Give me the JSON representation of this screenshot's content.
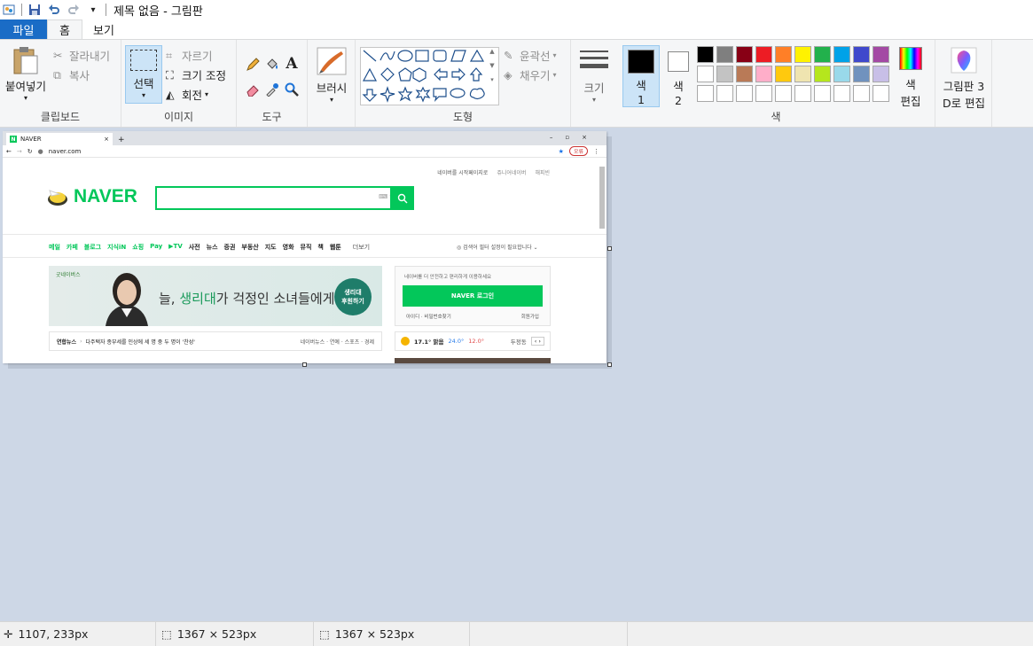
{
  "title": "제목 없음 - 그림판",
  "tabs": [
    "파일",
    "홈",
    "보기"
  ],
  "clipboard": {
    "paste": "붙여넣기",
    "cut": "잘라내기",
    "copy": "복사",
    "label": "클립보드"
  },
  "image": {
    "select": "선택",
    "crop": "자르기",
    "resize": "크기 조정",
    "rotate": "회전",
    "label": "이미지"
  },
  "tools": {
    "label": "도구"
  },
  "brushes": {
    "label": "브러시"
  },
  "shapes": {
    "outline": "윤곽선",
    "fill": "채우기",
    "label": "도형"
  },
  "size": {
    "label": "크기"
  },
  "colors": {
    "color1_label": "색",
    "color1_num": "1",
    "color2_label": "색",
    "color2_num": "2",
    "label": "색",
    "edit_label1": "색",
    "edit_label2": "편집",
    "paint3d_label1": "그림판 3",
    "paint3d_label2": "D로 편집",
    "color1": "#000000",
    "color2": "#ffffff",
    "palette_row1": [
      "#000000",
      "#7f7f7f",
      "#880015",
      "#ed1c24",
      "#ff7f27",
      "#fff200",
      "#22b14c",
      "#00a2e8",
      "#3f48cc",
      "#a349a4"
    ],
    "palette_row2": [
      "#ffffff",
      "#c3c3c3",
      "#b97a57",
      "#ffaec9",
      "#ffc90e",
      "#efe4b0",
      "#b5e61d",
      "#99d9ea",
      "#7092be",
      "#c8bfe7"
    ],
    "palette_row3": [
      "#ffffff",
      "#ffffff",
      "#ffffff",
      "#ffffff",
      "#ffffff",
      "#ffffff",
      "#ffffff",
      "#ffffff",
      "#ffffff",
      "#ffffff"
    ]
  },
  "status": {
    "position": "1107, 233px",
    "selection_size": "1367 × 523px",
    "image_size": "1367 × 523px"
  },
  "browser": {
    "tab_title": "NAVER",
    "url": "naver.com",
    "profile_badge": "오류",
    "top_links": "네이버를 시작페이지로",
    "top_links2": "쥬니어네이버",
    "top_links3": "해피빈",
    "logo": "NAVER",
    "menu": [
      "메일",
      "카페",
      "블로그",
      "지식iN",
      "쇼핑",
      "Pay",
      "▶TV",
      "사전",
      "뉴스",
      "증권",
      "부동산",
      "지도",
      "영화",
      "뮤직",
      "책",
      "웹툰",
      "더보기"
    ],
    "notice": "검색어 필터 설정이 필요합니다",
    "banner_brand": "굿네이버스",
    "banner_text_1": "늘, ",
    "banner_text_highlight": "생리대",
    "banner_text_2": "가 걱정인 소녀들에게",
    "banner_button_1": "생리대",
    "banner_button_2": "후원하기",
    "login_desc": "네이버를 더 안전하고 편리하게 이용하세요",
    "login_button": "NAVER 로그인",
    "login_links": "아이디 · 비밀번호찾기",
    "login_join": "회원가입",
    "news_source": "연합뉴스",
    "news_headline": "다주택자 종부세를 인상에 세 명 중 두 명이 '찬성'",
    "news_tabs": "네이버뉴스 · 연예 · 스포츠 · 경제",
    "weather_temp": "17.1° 맑음",
    "weather_hi": "24.0°",
    "weather_lo": "12.0°",
    "weather_loc": "두정동"
  }
}
